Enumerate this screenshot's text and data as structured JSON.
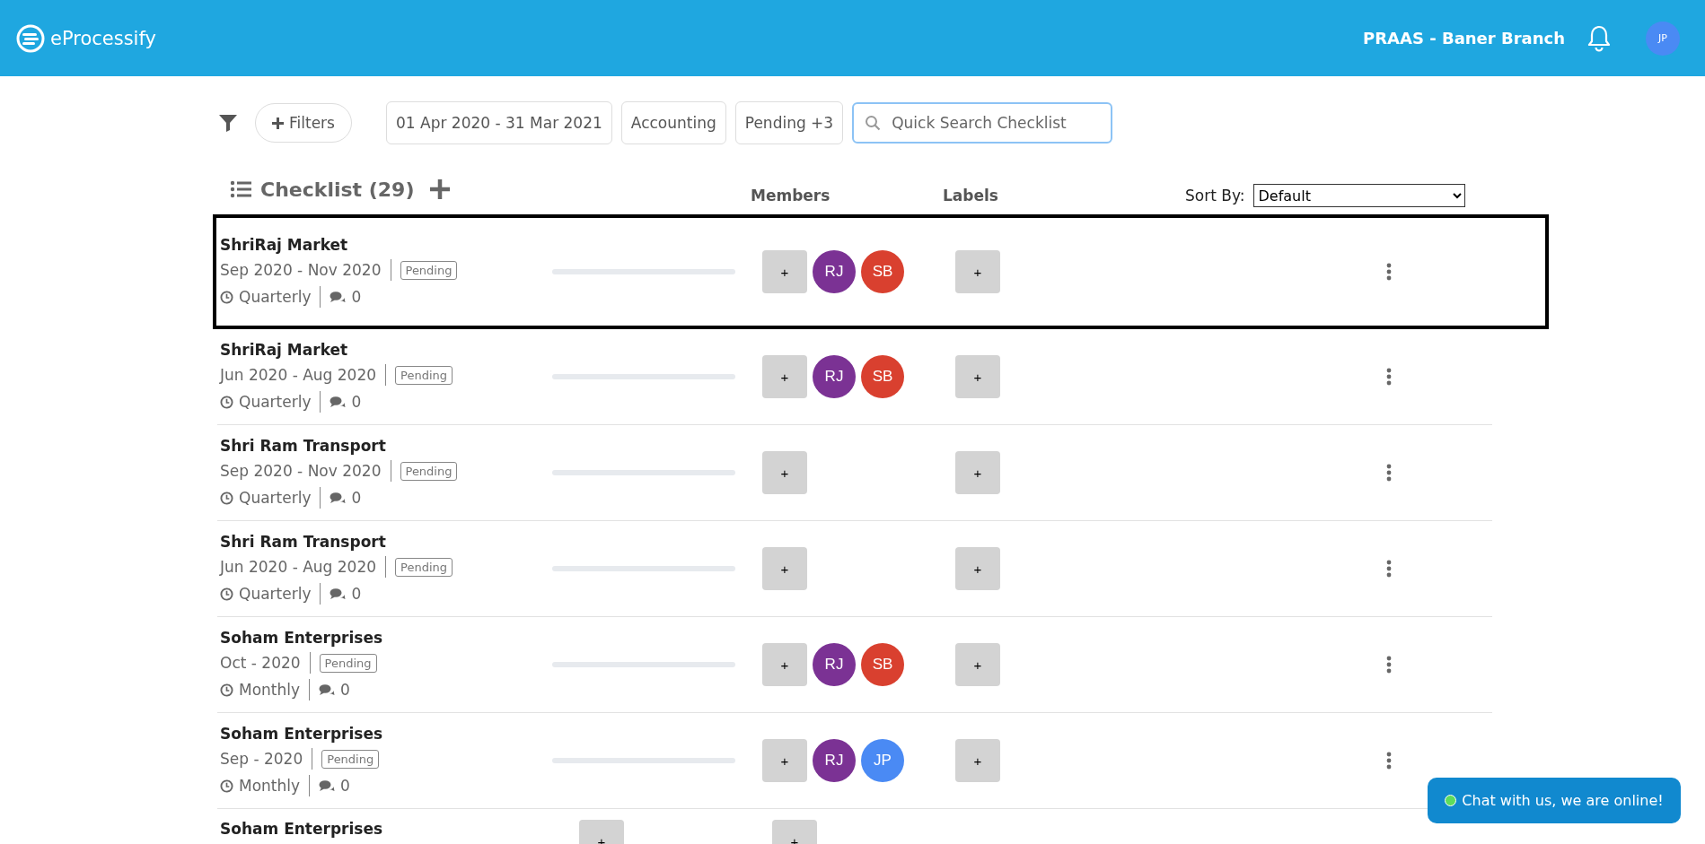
{
  "header": {
    "brand": "eProcessify",
    "branch": "PRAAS - Baner Branch",
    "user_initials": "JP"
  },
  "filters": {
    "button": "Filters",
    "chips": [
      "01 Apr 2020 - 31 Mar 2021",
      "Accounting",
      "Pending +3"
    ],
    "search": {
      "placeholder": "Quick Search Checklist"
    }
  },
  "list_header": {
    "title": "Checklist (29)",
    "columns": [
      "Members",
      "Labels"
    ],
    "sort_label": "Sort By:",
    "sort_value": "Default"
  },
  "rows": [
    {
      "name": "ShriRaj Market",
      "period": "Sep 2020 - Nov 2020",
      "status": "Pending",
      "frequency": "Quarterly",
      "comments": "0",
      "level": 0,
      "selected": true,
      "add_member": "+",
      "add_label": "+",
      "members": [
        {
          "initials": "RJ",
          "color": "#7b3294"
        },
        {
          "initials": "SB",
          "color": "#d9402f"
        }
      ]
    },
    {
      "name": "ShriRaj Market",
      "period": "Jun 2020 - Aug 2020",
      "status": "Pending",
      "frequency": "Quarterly",
      "comments": "0",
      "level": 0,
      "selected": false,
      "add_member": "+",
      "add_label": "+",
      "members": [
        {
          "initials": "RJ",
          "color": "#7b3294"
        },
        {
          "initials": "SB",
          "color": "#d9402f"
        }
      ]
    },
    {
      "name": "Shri Ram Transport",
      "period": "Sep 2020 - Nov 2020",
      "status": "Pending",
      "frequency": "Quarterly",
      "comments": "0",
      "level": 0,
      "selected": false,
      "add_member": "+",
      "add_label": "+",
      "members": []
    },
    {
      "name": "Shri Ram Transport",
      "period": "Jun 2020 - Aug 2020",
      "status": "Pending",
      "frequency": "Quarterly",
      "comments": "0",
      "level": 0,
      "selected": false,
      "add_member": "+",
      "add_label": "+",
      "members": []
    },
    {
      "name": "Soham Enterprises",
      "period": "Oct - 2020",
      "status": "Pending",
      "frequency": "Monthly",
      "comments": "0",
      "level": 0,
      "selected": false,
      "add_member": "+",
      "add_label": "+",
      "members": [
        {
          "initials": "RJ",
          "color": "#7b3294"
        },
        {
          "initials": "SB",
          "color": "#d9402f"
        }
      ]
    },
    {
      "name": "Soham Enterprises",
      "period": "Sep - 2020",
      "status": "Pending",
      "frequency": "Monthly",
      "comments": "0",
      "level": 0,
      "selected": false,
      "add_member": "+",
      "add_label": "+",
      "members": [
        {
          "initials": "RJ",
          "color": "#7b3294"
        },
        {
          "initials": "JP",
          "color": "#4a8af4"
        }
      ]
    },
    {
      "name": "Soham Enterprises",
      "selected": false,
      "add_member": "+",
      "add_label": "+"
    }
  ],
  "chat": {
    "label": "Chat with us, we are online!"
  }
}
